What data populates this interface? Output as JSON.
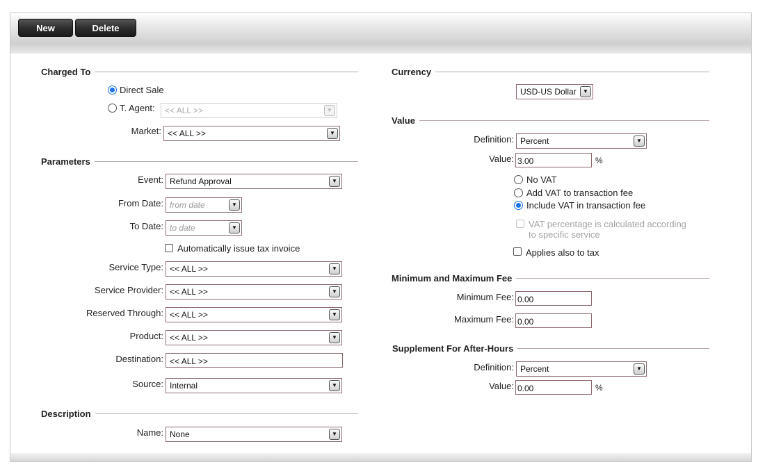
{
  "toolbar": {
    "new_label": "New",
    "delete_label": "Delete"
  },
  "charged_to": {
    "title": "Charged To",
    "direct_sale_label": "Direct Sale",
    "t_agent_label": "T. Agent:",
    "t_agent_value": "<< ALL >>",
    "market_label": "Market:",
    "market_value": "<< ALL >>",
    "selected": "Direct Sale"
  },
  "parameters": {
    "title": "Parameters",
    "event_label": "Event:",
    "event_value": "Refund Approval",
    "from_date_label": "From Date:",
    "from_date_placeholder": "from date",
    "to_date_label": "To Date:",
    "to_date_placeholder": "to date",
    "auto_tax_label": "Automatically issue tax invoice",
    "service_type_label": "Service Type:",
    "service_type_value": "<< ALL >>",
    "service_provider_label": "Service Provider:",
    "service_provider_value": "<< ALL >>",
    "reserved_through_label": "Reserved Through:",
    "reserved_through_value": "<< ALL >>",
    "product_label": "Product:",
    "product_value": "<< ALL >>",
    "destination_label": "Destination:",
    "destination_value": "<< ALL >>",
    "source_label": "Source:",
    "source_value": "Internal"
  },
  "description": {
    "title": "Description",
    "name_label": "Name:",
    "name_value": "None"
  },
  "currency": {
    "title": "Currency",
    "value": "USD-US Dollar"
  },
  "value": {
    "title": "Value",
    "definition_label": "Definition:",
    "definition_value": "Percent",
    "value_label": "Value:",
    "value_value": "3.00",
    "unit": "%",
    "no_vat_label": "No VAT",
    "add_vat_label": "Add VAT to transaction fee",
    "include_vat_label": "Include VAT in transaction fee",
    "vat_selected": "Include VAT in transaction fee",
    "vat_percentage_line1": "VAT percentage is calculated according",
    "vat_percentage_line2": "to specific service",
    "applies_tax_label": "Applies also to tax"
  },
  "min_max": {
    "title": "Minimum and Maximum Fee",
    "min_label": "Minimum Fee:",
    "min_value": "0.00",
    "max_label": "Maximum Fee:",
    "max_value": "0.00"
  },
  "supplement": {
    "title": "Supplement For After-Hours",
    "definition_label": "Definition:",
    "definition_value": "Percent",
    "value_label": "Value:",
    "value_value": "0.00",
    "unit": "%"
  },
  "icons": {
    "dropdown": "chevron-down-icon"
  },
  "colors": {
    "radio_selected": "#1a73e8",
    "field_border": "#8e6a6f",
    "toolbar_button": "#2e2e2e"
  }
}
